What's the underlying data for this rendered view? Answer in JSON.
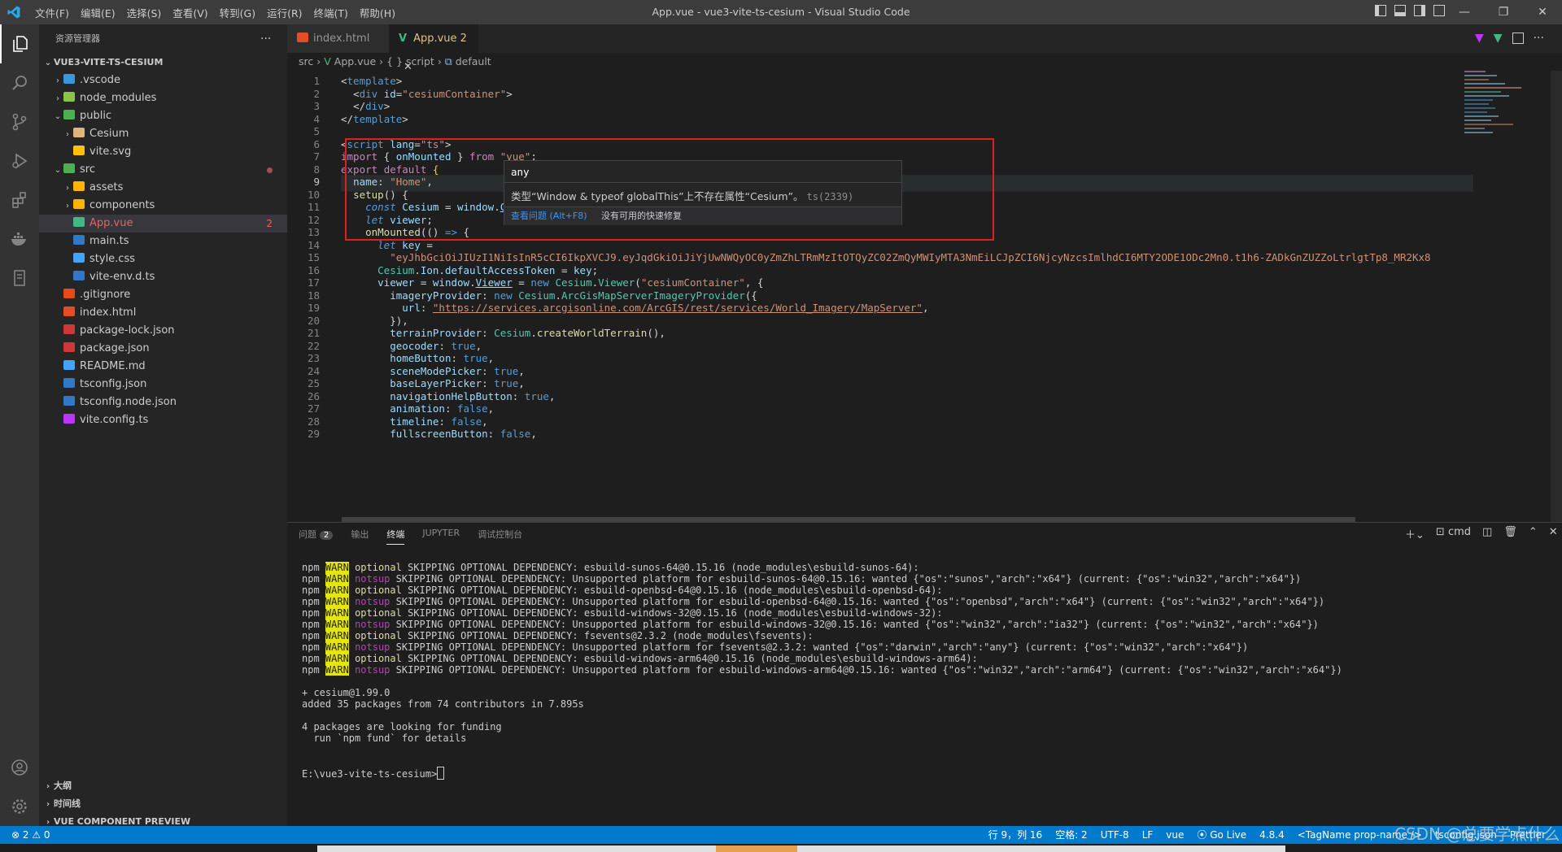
{
  "window": {
    "title": "App.vue - vue3-vite-ts-cesium - Visual Studio Code",
    "menu": [
      "文件(F)",
      "编辑(E)",
      "选择(S)",
      "查看(V)",
      "转到(G)",
      "运行(R)",
      "终端(T)",
      "帮助(H)"
    ],
    "controls": {
      "minimize": "—",
      "restore": "❐",
      "close": "✕"
    }
  },
  "sidebar": {
    "header": "资源管理器",
    "more": "···",
    "project": "VUE3-VITE-TS-CESIUM",
    "tree": [
      {
        "label": ".vscode",
        "chev": "›",
        "icon": "#3a96dd"
      },
      {
        "label": "node_modules",
        "chev": "›",
        "icon": "#8bc34a"
      },
      {
        "label": "public",
        "chev": "⌄",
        "icon": "#4caf50"
      },
      {
        "label": "Cesium",
        "chev": "›",
        "icon": "#dcb67a"
      },
      {
        "label": "vite.svg",
        "chev": "",
        "icon": "#ffc107"
      },
      {
        "label": "src",
        "chev": "⌄",
        "icon": "#4caf50"
      },
      {
        "label": "assets",
        "chev": "›",
        "icon": "#ffb300"
      },
      {
        "label": "components",
        "chev": "›",
        "icon": "#ffb300"
      },
      {
        "label": "App.vue",
        "chev": "",
        "icon": "#41b883",
        "badge": "2"
      },
      {
        "label": "main.ts",
        "chev": "",
        "icon": "#3178c6"
      },
      {
        "label": "style.css",
        "chev": "",
        "icon": "#42a5f5"
      },
      {
        "label": "vite-env.d.ts",
        "chev": "",
        "icon": "#3178c6"
      },
      {
        "label": ".gitignore",
        "chev": "",
        "icon": "#e64a19"
      },
      {
        "label": "index.html",
        "chev": "",
        "icon": "#e44d26"
      },
      {
        "label": "package-lock.json",
        "chev": "",
        "icon": "#cb3837"
      },
      {
        "label": "package.json",
        "chev": "",
        "icon": "#cb3837"
      },
      {
        "label": "README.md",
        "chev": "",
        "icon": "#42a5f5"
      },
      {
        "label": "tsconfig.json",
        "chev": "",
        "icon": "#3178c6"
      },
      {
        "label": "tsconfig.node.json",
        "chev": "",
        "icon": "#3178c6"
      },
      {
        "label": "vite.config.ts",
        "chev": "",
        "icon": "#bd34fe"
      }
    ],
    "sections": [
      "大纲",
      "时间线",
      "VUE COMPONENT PREVIEW"
    ]
  },
  "tabs": [
    {
      "label": "index.html"
    },
    {
      "label": "App.vue",
      "count": "2",
      "close": "✕"
    }
  ],
  "breadcrumb": {
    "a": "src",
    "b": "App.vue",
    "c": "{ } script",
    "d": "default"
  },
  "editor": {
    "current_line": "9",
    "lines": [
      {
        "n": "1",
        "html": "<span class='p'>&lt;</span><span class='tag'>template</span><span class='p'>&gt;</span>"
      },
      {
        "n": "2",
        "html": "  <span class='p'>&lt;</span><span class='tag'>div</span> <span class='v'>id</span>=<span class='s'>\"cesiumContainer\"</span><span class='p'>&gt;</span>"
      },
      {
        "n": "3",
        "html": "  <span class='p'>&lt;/</span><span class='tag'>div</span><span class='p'>&gt;</span>"
      },
      {
        "n": "4",
        "html": "<span class='p'>&lt;/</span><span class='tag'>template</span><span class='p'>&gt;</span>"
      },
      {
        "n": "5",
        "html": ""
      },
      {
        "n": "6",
        "html": "<span class='p'>&lt;</span><span class='tag'>script</span> <span class='v'>lang</span>=<span class='s'>\"ts\"</span><span class='p'>&gt;</span>"
      },
      {
        "n": "7",
        "html": "<span class='c'>import</span> { <span class='v'>onMounted</span> } <span class='c'>from</span> <span class='s'>\"vue\"</span>;"
      },
      {
        "n": "8",
        "html": "<span class='c'>export</span> <span class='c'>default</span> <span class='b'>{</span>"
      },
      {
        "n": "9",
        "html": "  <span class='v'>name</span>: <span class='s'>\"Home\"</span>,"
      },
      {
        "n": "10",
        "html": "  <span class='f'>setup</span>() {"
      },
      {
        "n": "11",
        "html": "    <span class='k'><i>const</i></span> <span class='v'>Cesium</span> <span class='p'>=</span> <span class='v'>window</span>.<span class='v u'>Cesium</span>;"
      },
      {
        "n": "12",
        "html": "    <span class='k'><i>let</i></span> <span class='v'>viewer</span>;"
      },
      {
        "n": "13",
        "html": "    <span class='f'>onMounted</span>(() <span class='k'>=&gt;</span> {"
      },
      {
        "n": "14",
        "html": "      <span class='k'><i>let</i></span> <span class='v'>key</span> <span class='p'>=</span>"
      },
      {
        "n": "15",
        "html": "        <span class='s'>\"eyJhbGciOiJIUzI1NiIsInR5cCI6IkpXVCJ9.eyJqdGkiOiJiYjUwNWQyOC0yZmZhLTRmMzItOTQyZC02ZmQyMWIyMTA3NmEiLCJpZCI6NjcyNzcsImlhdCI6MTY2ODE1ODc2Mn0.t1h6-ZADkGnZUZZoLtrlgtTp8_MR2Kx8</span>"
      },
      {
        "n": "16",
        "html": "      <span class='t'>Cesium</span>.<span class='v'>Ion</span>.<span class='v'>defaultAccessToken</span> <span class='p'>=</span> <span class='v'>key</span>;"
      },
      {
        "n": "17",
        "html": "      <span class='v'>viewer</span> <span class='p'>=</span> <span class='v'>window</span>.<span class='v u'>Viewer</span> <span class='p'>=</span> <span class='k'>new</span> <span class='t'>Cesium</span>.<span class='t'>Viewer</span>(<span class='s'>\"cesiumContainer\"</span>, {"
      },
      {
        "n": "18",
        "html": "        <span class='v'>imageryProvider</span>: <span class='k'>new</span> <span class='t'>Cesium</span>.<span class='t'>ArcGisMapServerImageryProvider</span>({"
      },
      {
        "n": "19",
        "html": "          <span class='v'>url</span>: <span class='s u'>\"https://services.arcgisonline.com/ArcGIS/rest/services/World_Imagery/MapServer\"</span>,"
      },
      {
        "n": "20",
        "html": "        }),"
      },
      {
        "n": "21",
        "html": "        <span class='v'>terrainProvider</span>: <span class='t'>Cesium</span>.<span class='f'>createWorldTerrain</span>(),"
      },
      {
        "n": "22",
        "html": "        <span class='v'>geocoder</span>: <span class='k'>true</span>,"
      },
      {
        "n": "23",
        "html": "        <span class='v'>homeButton</span>: <span class='k'>true</span>,"
      },
      {
        "n": "24",
        "html": "        <span class='v'>sceneModePicker</span>: <span class='k'>true</span>,"
      },
      {
        "n": "25",
        "html": "        <span class='v'>baseLayerPicker</span>: <span class='k'>true</span>,"
      },
      {
        "n": "26",
        "html": "        <span class='v'>navigationHelpButton</span>: <span class='k'>true</span>,"
      },
      {
        "n": "27",
        "html": "        <span class='v'>animation</span>: <span class='k'>false</span>,"
      },
      {
        "n": "28",
        "html": "        <span class='v'>timeline</span>: <span class='k'>false</span>,"
      },
      {
        "n": "29",
        "html": "        <span class='v'>fullscreenButton</span>: <span class='k'>false</span>,"
      }
    ]
  },
  "hover": {
    "type": "any",
    "message": "类型“Window & typeof globalThis”上不存在属性“Cesium”。",
    "code": "ts(2339)",
    "link": "查看问题 (Alt+F8)",
    "nofix": "没有可用的快速修复"
  },
  "panel": {
    "tabs": [
      "问题",
      "输出",
      "终端",
      "JUPYTER",
      "调试控制台"
    ],
    "problem_count": "2",
    "shell": "cmd",
    "terminal": [
      {
        "a": "optional",
        "b": " SKIPPING OPTIONAL DEPENDENCY: esbuild-sunos-64@0.15.16 (node_modules\\esbuild-sunos-64):"
      },
      {
        "a": "notsup",
        "b": " SKIPPING OPTIONAL DEPENDENCY: Unsupported platform for esbuild-sunos-64@0.15.16: wanted {\"os\":\"sunos\",\"arch\":\"x64\"} (current: {\"os\":\"win32\",\"arch\":\"x64\"})"
      },
      {
        "a": "optional",
        "b": " SKIPPING OPTIONAL DEPENDENCY: esbuild-openbsd-64@0.15.16 (node_modules\\esbuild-openbsd-64):"
      },
      {
        "a": "notsup",
        "b": " SKIPPING OPTIONAL DEPENDENCY: Unsupported platform for esbuild-openbsd-64@0.15.16: wanted {\"os\":\"openbsd\",\"arch\":\"x64\"} (current: {\"os\":\"win32\",\"arch\":\"x64\"})"
      },
      {
        "a": "optional",
        "b": " SKIPPING OPTIONAL DEPENDENCY: esbuild-windows-32@0.15.16 (node_modules\\esbuild-windows-32):"
      },
      {
        "a": "notsup",
        "b": " SKIPPING OPTIONAL DEPENDENCY: Unsupported platform for esbuild-windows-32@0.15.16: wanted {\"os\":\"win32\",\"arch\":\"ia32\"} (current: {\"os\":\"win32\",\"arch\":\"x64\"})"
      },
      {
        "a": "optional",
        "b": " SKIPPING OPTIONAL DEPENDENCY: fsevents@2.3.2 (node_modules\\fsevents):"
      },
      {
        "a": "notsup",
        "b": " SKIPPING OPTIONAL DEPENDENCY: Unsupported platform for fsevents@2.3.2: wanted {\"os\":\"darwin\",\"arch\":\"any\"} (current: {\"os\":\"win32\",\"arch\":\"x64\"})"
      },
      {
        "a": "optional",
        "b": " SKIPPING OPTIONAL DEPENDENCY: esbuild-windows-arm64@0.15.16 (node_modules\\esbuild-windows-arm64):"
      },
      {
        "a": "notsup",
        "b": " SKIPPING OPTIONAL DEPENDENCY: Unsupported platform for esbuild-windows-arm64@0.15.16: wanted {\"os\":\"win32\",\"arch\":\"arm64\"} (current: {\"os\":\"win32\",\"arch\":\"x64\"})"
      }
    ],
    "npm": "npm",
    "warn": "WARN",
    "after": [
      "+ cesium@1.99.0",
      "added 35 packages from 74 contributors in 7.895s",
      "",
      "4 packages are looking for funding",
      "  run `npm fund` for details",
      "",
      ""
    ],
    "prompt": "E:\\vue3-vite-ts-cesium>"
  },
  "status": {
    "errors": "⊗ 2 ⚠ 0",
    "items": [
      "行 9，列 16",
      "空格: 2",
      "UTF-8",
      "LF",
      "vue",
      "Go Live",
      "4.8.4",
      "<TagName prop-name />",
      "tsconfig.json",
      "Prettier"
    ]
  },
  "watermark": "CSDN @总要学点什么",
  "colors": {
    "accent": "#007acc",
    "error": "#e02020"
  }
}
